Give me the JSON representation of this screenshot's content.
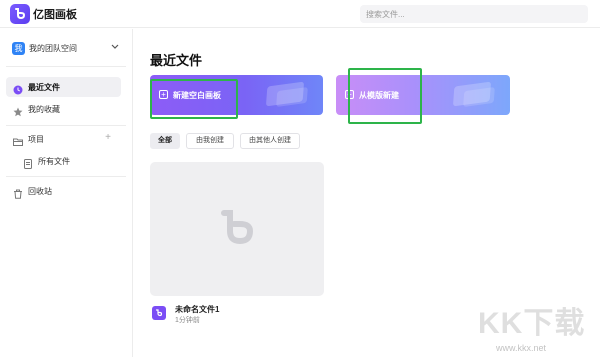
{
  "app": {
    "name": "亿图画板",
    "logo_icon": "eddx-logo-icon"
  },
  "search": {
    "placeholder": "搜索文件..."
  },
  "sidebar": {
    "team_label": "我的团队空间",
    "team_avatar_text": "我",
    "items": [
      {
        "label": "最近文件",
        "icon": "clock-icon",
        "active": true
      },
      {
        "label": "我的收藏",
        "icon": "star-icon",
        "active": false
      },
      {
        "label": "项目",
        "icon": "folder-icon",
        "active": false
      },
      {
        "label": "所有文件",
        "icon": "file-icon",
        "active": false
      },
      {
        "label": "回收站",
        "icon": "trash-icon",
        "active": false
      }
    ],
    "add_symbol": "+"
  },
  "main": {
    "title": "最近文件",
    "cards": [
      {
        "label": "新建空白画板",
        "icon": "plus-square-icon"
      },
      {
        "label": "从模版新建",
        "icon": "plus-square-icon"
      }
    ],
    "filters": [
      {
        "label": "全部",
        "active": true
      },
      {
        "label": "由我创建",
        "active": false
      },
      {
        "label": "由其他人创建",
        "active": false
      }
    ],
    "files": [
      {
        "name": "未命名文件1",
        "time": "1分钟前"
      }
    ]
  },
  "watermark": {
    "text": "KK下载",
    "url": "www.kkx.net"
  },
  "colors": {
    "accent": "#7b4df5",
    "highlight": "#2db44a",
    "active_bg": "#f0f0f3"
  }
}
